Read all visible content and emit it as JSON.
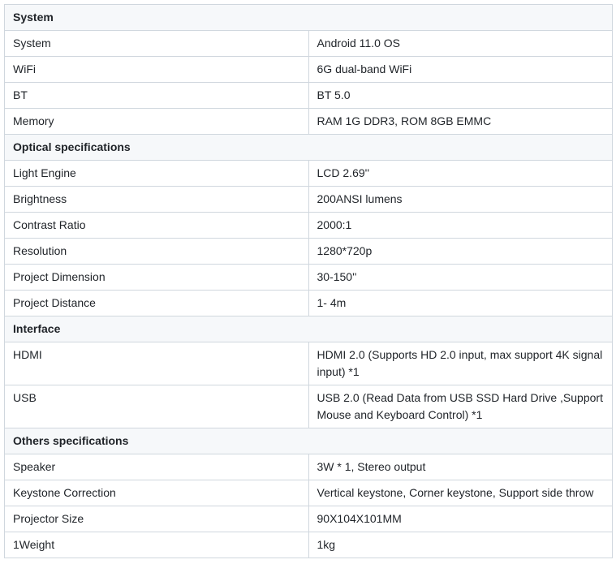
{
  "sections": [
    {
      "title": "System",
      "rows": [
        {
          "label": "System",
          "value": "Android 11.0 OS"
        },
        {
          "label": "WiFi",
          "value": "6G dual-band WiFi"
        },
        {
          "label": "BT",
          "value": "BT 5.0"
        },
        {
          "label": "Memory",
          "value": "RAM 1G DDR3, ROM 8GB EMMC"
        }
      ]
    },
    {
      "title": "Optical specifications",
      "rows": [
        {
          "label": "Light Engine",
          "value": "LCD 2.69''"
        },
        {
          "label": "Brightness",
          "value": "200ANSI lumens"
        },
        {
          "label": "Contrast Ratio",
          "value": "2000:1"
        },
        {
          "label": "Resolution",
          "value": "1280*720p"
        },
        {
          "label": "Project Dimension",
          "value": "30-150''"
        },
        {
          "label": "Project Distance",
          "value": "1- 4m"
        }
      ]
    },
    {
      "title": "Interface",
      "rows": [
        {
          "label": "HDMI",
          "value": "HDMI 2.0 (Supports HD 2.0 input, max support 4K signal input) *1"
        },
        {
          "label": "USB",
          "value": "USB 2.0 (Read Data from USB SSD Hard Drive ,Support Mouse and Keyboard Control) *1"
        }
      ]
    },
    {
      "title": "Others specifications",
      "rows": [
        {
          "label": "Speaker",
          "value": "3W * 1, Stereo output"
        },
        {
          "label": "Keystone Correction",
          "value": "Vertical keystone, Corner keystone, Support side throw"
        },
        {
          "label": "Projector Size",
          "value": "90X104X101MM"
        },
        {
          "label": "1Weight",
          "value": "1kg"
        }
      ]
    }
  ]
}
